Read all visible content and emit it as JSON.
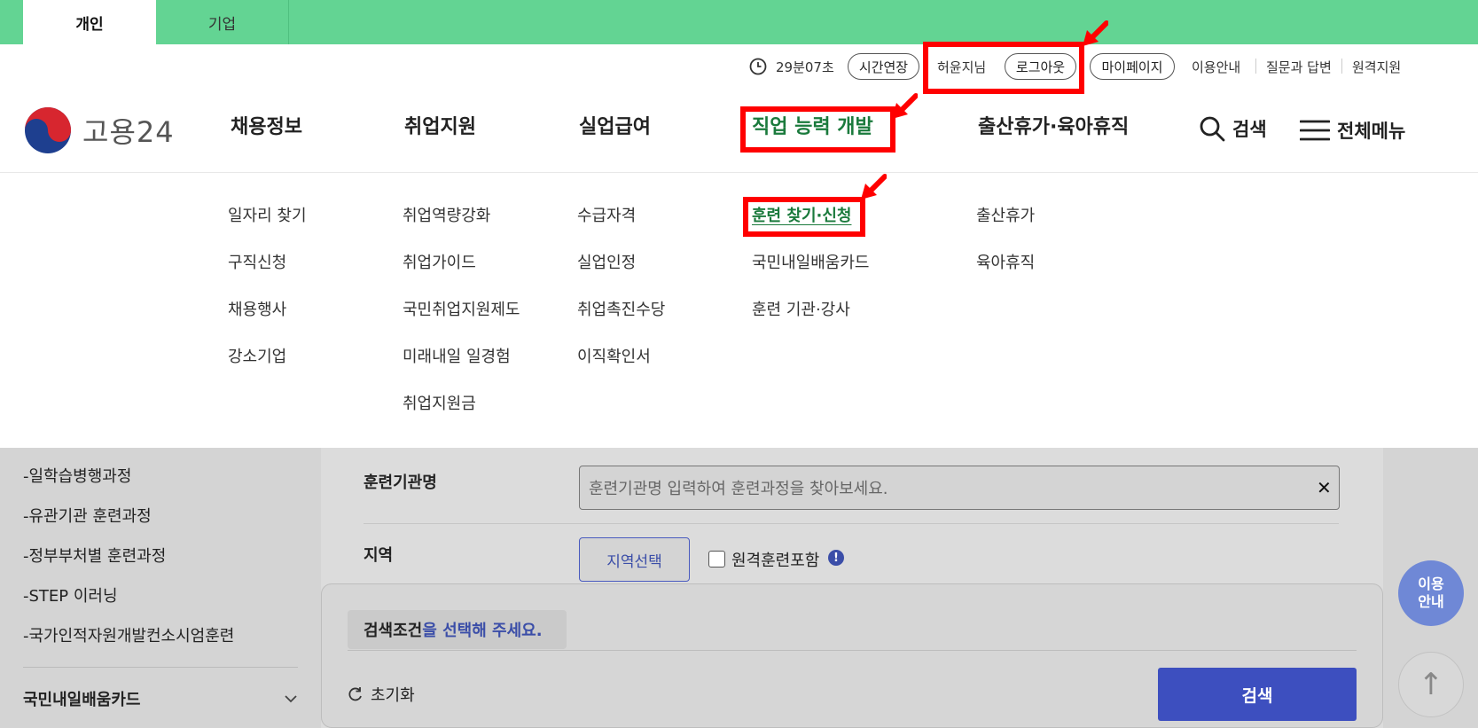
{
  "top_tabs": [
    "개인",
    "기업"
  ],
  "util": {
    "timer": "29분07초",
    "extend": "시간연장",
    "user": "허윤지님",
    "logout": "로그아웃",
    "mypage": "마이페이지",
    "links": [
      "이용안내",
      "질문과 답변",
      "원격지원"
    ]
  },
  "logo": {
    "text": "고용24"
  },
  "gnb": [
    "채용정보",
    "취업지원",
    "실업급여",
    "직업 능력 개발",
    "출산휴가·육아휴직"
  ],
  "header_tools": {
    "search": "검색",
    "all_menu": "전체메뉴"
  },
  "submenu": {
    "col1": [
      "일자리 찾기",
      "구직신청",
      "채용행사",
      "강소기업"
    ],
    "col2": [
      "취업역량강화",
      "취업가이드",
      "국민취업지원제도",
      "미래내일 일경험",
      "취업지원금"
    ],
    "col3": [
      "수급자격",
      "실업인정",
      "취업촉진수당",
      "이직확인서"
    ],
    "col4": [
      "훈련 찾기·신청",
      "국민내일배움카드",
      "훈련 기관·강사"
    ],
    "col5": [
      "출산휴가",
      "육아휴직"
    ]
  },
  "sidebar": {
    "items": [
      "-일학습병행과정",
      "-유관기관 훈련과정",
      "-정부부처별 훈련과정",
      "-STEP 이러닝",
      "-국가인적자원개발컨소시엄훈련"
    ],
    "section": "국민내일배움카드"
  },
  "form": {
    "institution_label": "훈련기관명",
    "institution_placeholder": "훈련기관명 입력하여 훈련과정을 찾아보세요.",
    "region_label": "지역",
    "region_button": "지역선택",
    "remote_label": "원격훈련포함"
  },
  "result": {
    "cond_strong": "검색조건",
    "cond_rest": "을 선택해 주세요.",
    "reset": "초기화",
    "search": "검색"
  },
  "floating": {
    "guide": "이용 안내",
    "top_arrow": "↑"
  },
  "colors": {
    "topbar": "#63d493",
    "active_green": "#1a7a3c",
    "primary_blue": "#3d4fbf",
    "highlight_red": "#ff0000"
  }
}
